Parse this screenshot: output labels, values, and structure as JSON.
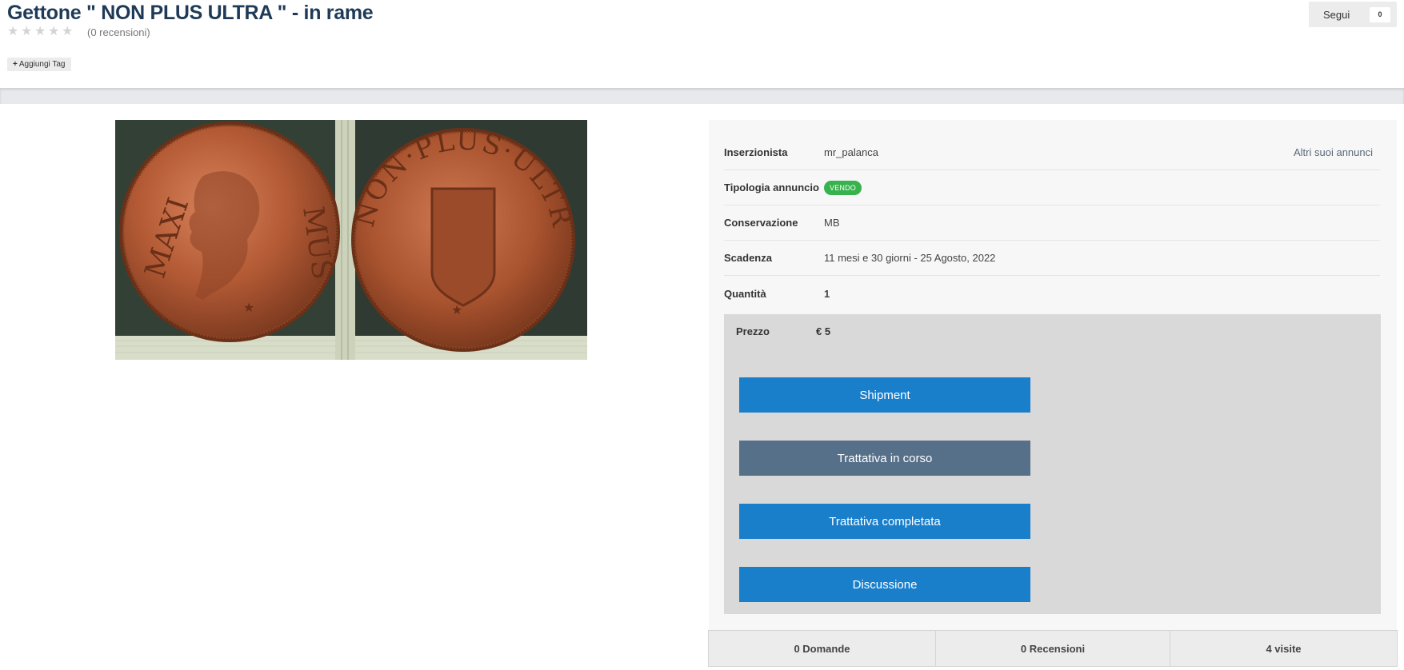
{
  "listing": {
    "title": "Gettone \" NON PLUS ULTRA \" - in rame",
    "reviews_text": "(0 recensioni)",
    "rating": 0,
    "add_tag_label": "Aggiungi Tag",
    "follow_label": "Segui",
    "follow_count": "0"
  },
  "image": {
    "left_legend": "MAXI MUS",
    "right_legend": "NON · PLUS · ULTRA"
  },
  "details": {
    "inserzionista_label": "Inserzionista",
    "inserzionista_value": "mr_palanca",
    "altri_annunci": "Altri suoi annunci",
    "tipologia_label": "Tipologia annuncio",
    "tipologia_badge": "VENDO",
    "conservazione_label": "Conservazione",
    "conservazione_value": "MB",
    "scadenza_label": "Scadenza",
    "scadenza_value": "11 mesi e 30 giorni - 25 Agosto, 2022",
    "quantita_label": "Quantità",
    "quantita_value": "1",
    "prezzo_label": "Prezzo",
    "prezzo_value": "€ 5"
  },
  "actions": {
    "shipment": "Shipment",
    "trattativa_in_corso": "Trattativa in corso",
    "trattativa_completata": "Trattativa completata",
    "discussione": "Discussione"
  },
  "stats": {
    "domande": "0 Domande",
    "recensioni": "0 Recensioni",
    "visite": "4 visite"
  },
  "colors": {
    "title": "#1f3a57",
    "primary_button": "#1a7fcb",
    "secondary_button": "#567089",
    "badge": "#37b24d"
  }
}
